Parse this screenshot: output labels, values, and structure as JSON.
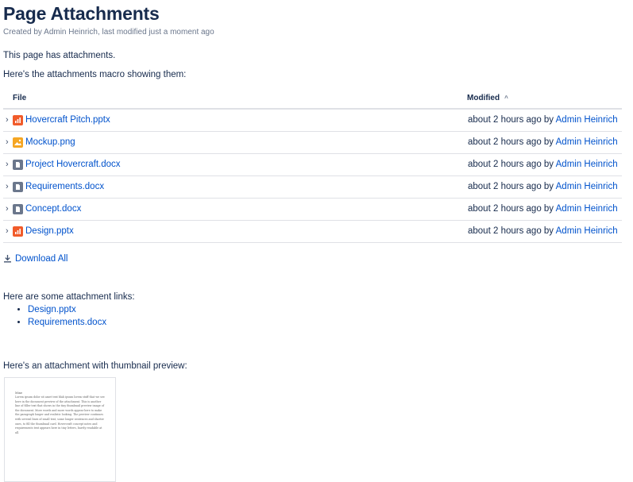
{
  "page": {
    "title": "Page Attachments",
    "byline": "Created by Admin Heinrich, last modified just a moment ago",
    "intro": "This page has attachments.",
    "macro_intro": "Here's the attachments macro showing them:",
    "links_intro": "Here are some attachment links:",
    "thumb_intro": "Here's an attachment with thumbnail preview:"
  },
  "table": {
    "col_file": "File",
    "col_modified": "Modified",
    "sort_indicator": "^",
    "rows": [
      {
        "name": "Hovercraft Pitch.pptx",
        "icon": "pptx-icon",
        "color": "#F15B2A",
        "modified": "about 2 hours ago by ",
        "user": "Admin Heinrich"
      },
      {
        "name": "Mockup.png",
        "icon": "image-icon",
        "color": "#F5A623",
        "modified": "about 2 hours ago by ",
        "user": "Admin Heinrich"
      },
      {
        "name": "Project Hovercraft.docx",
        "icon": "docx-icon",
        "color": "#6B778C",
        "modified": "about 2 hours ago by ",
        "user": "Admin Heinrich"
      },
      {
        "name": "Requirements.docx",
        "icon": "docx-icon",
        "color": "#6B778C",
        "modified": "about 2 hours ago by ",
        "user": "Admin Heinrich"
      },
      {
        "name": "Concept.docx",
        "icon": "docx-icon",
        "color": "#6B778C",
        "modified": "about 2 hours ago by ",
        "user": "Admin Heinrich"
      },
      {
        "name": "Design.pptx",
        "icon": "pptx-icon",
        "color": "#F15B2A",
        "modified": "about 2 hours ago by ",
        "user": "Admin Heinrich"
      }
    ]
  },
  "download_all": "Download All",
  "links": [
    "Design.pptx",
    "Requirements.docx"
  ],
  "thumbnail": {
    "title": "Mine",
    "body": "Lorem ipsum dolor sit amet text blah ipsum lorem stuff that we see here in the document preview of the attachment. This is another line of filler text that shows in the tiny thumbnail preview image of the document. More words and more words appear here to make the paragraph longer and realistic looking. The preview continues with several lines of small text, some longer sentences and shorter ones, to fill the thumbnail card. Hovercraft concept notes and requirements text appears here in tiny letters, barely readable at all."
  },
  "colors": {
    "link": "#0052CC",
    "text": "#172B4D",
    "muted": "#6B778C",
    "border": "#DFE1E6"
  }
}
